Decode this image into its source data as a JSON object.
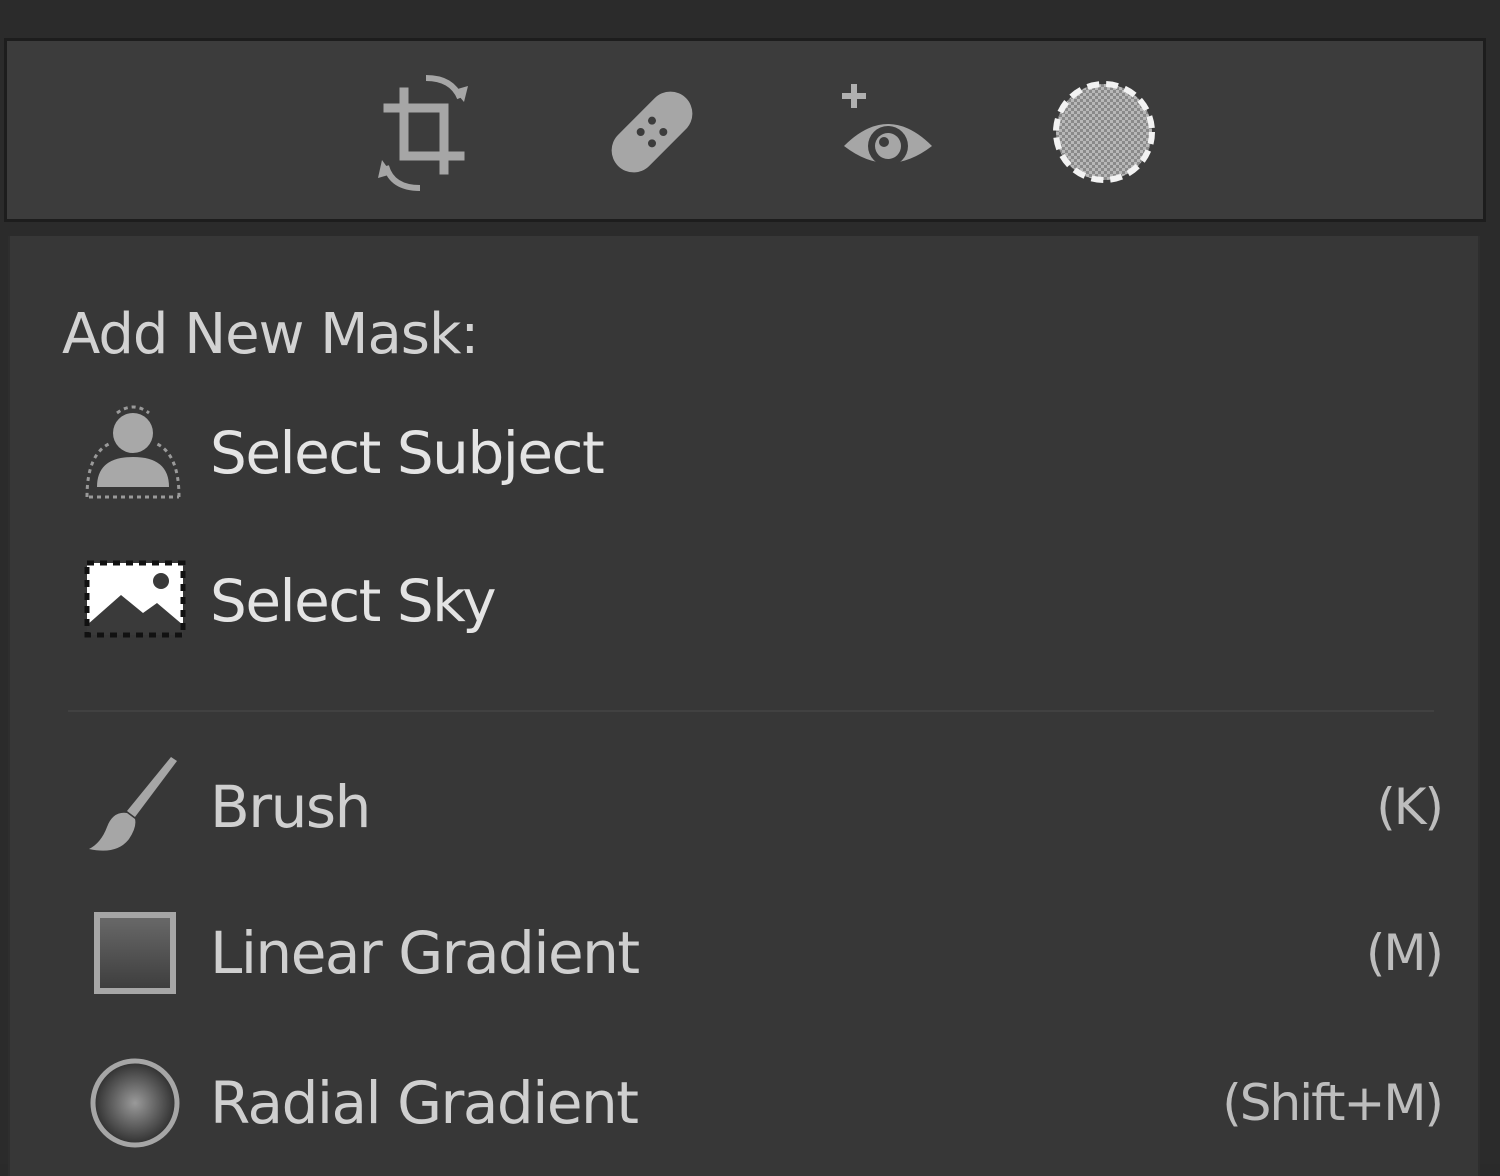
{
  "toolbar": {
    "tools": [
      {
        "name": "crop-overlay",
        "icon": "crop-rotate-icon"
      },
      {
        "name": "spot-removal",
        "icon": "bandage-icon"
      },
      {
        "name": "red-eye-correction",
        "icon": "red-eye-plus-icon"
      },
      {
        "name": "masking",
        "icon": "mask-circle-icon",
        "active": true
      }
    ]
  },
  "mask_menu": {
    "heading": "Add New Mask:",
    "items": [
      {
        "label": "Select Subject",
        "shortcut": "",
        "icon": "select-subject-icon"
      },
      {
        "label": "Select Sky",
        "shortcut": "",
        "icon": "select-sky-icon"
      },
      {
        "label": "Brush",
        "shortcut": "(K)",
        "icon": "brush-icon"
      },
      {
        "label": "Linear Gradient",
        "shortcut": "(M)",
        "icon": "linear-gradient-icon"
      },
      {
        "label": "Radial Gradient",
        "shortcut": "(Shift+M)",
        "icon": "radial-gradient-icon"
      }
    ]
  },
  "colors": {
    "background": "#2b2b2b",
    "toolstrip": "#3c3c3c",
    "panel": "#373737",
    "text": "#cfcfcf",
    "icon": "#a8a8a8"
  }
}
